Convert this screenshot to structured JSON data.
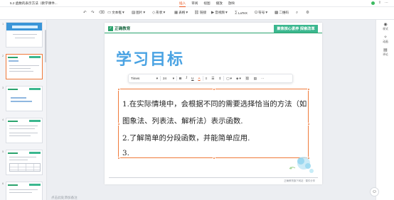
{
  "app": {
    "doc_title": "5.2 函数的表示方法（教学课件..."
  },
  "menu": {
    "tabs": [
      "插入",
      "审阅",
      "视图",
      "播放",
      "放映"
    ],
    "active": "插入"
  },
  "toolbar": {
    "undo": "↶",
    "redo": "↷",
    "format_painter": "⌫",
    "textbox": "文本框",
    "image": "图片",
    "shape": "形状",
    "table": "表格",
    "link": "链接",
    "audio_video": "音视频",
    "latex": "LaTeX",
    "symbol": "符号",
    "qrcode": "二维码"
  },
  "slides_panel": {
    "numbers": [
      "1",
      "2",
      "3",
      "4",
      "5",
      "6"
    ]
  },
  "slide": {
    "brand": "正确教育",
    "slogan": "聚焦核心素养 探索改革",
    "title": "学习目标",
    "lines": [
      "1.在实际情境中，会根据不同的需要选择恰当的方法（如",
      "图象法、列表法、解析法）表示函数.",
      "2.了解简单的分段函数，并能简单应用.",
      "3."
    ],
    "footer": "正确教育旗下网站 · 课件分享"
  },
  "format_bar": {
    "font": "Times",
    "size": "24",
    "bold": "B",
    "italic": "I",
    "underline": "U",
    "color": "A",
    "more": "···"
  },
  "notes_placeholder": "点击此处添加备注",
  "right_panel": {
    "items": [
      "样式",
      "动画",
      "评论"
    ]
  },
  "colors": {
    "accent": "#e8541c",
    "brand_green": "#2aa36d",
    "title_blue": "#4aa3e3",
    "selection": "#f07a3a"
  }
}
